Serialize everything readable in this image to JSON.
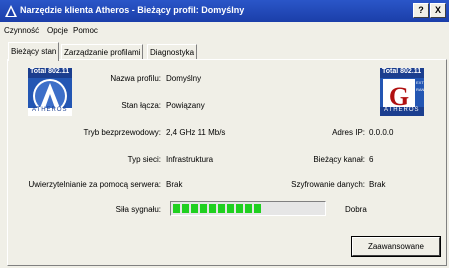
{
  "window": {
    "title": "Narzędzie klienta Atheros - Bieżący profil: Domyślny",
    "help_btn": "?",
    "close_btn": "X"
  },
  "menu": [
    "Czynność",
    "Opcje",
    "Pomoc"
  ],
  "tabs": [
    "Bieżący stan",
    "Zarządzanie profilami",
    "Diagnostyka"
  ],
  "logos": {
    "left": {
      "badge": "Total 802.11",
      "brand": "ATHEROS"
    },
    "right": {
      "badge": "Total 802.11",
      "brand": "ATHEROS",
      "side": "EXTENDED RANGE"
    }
  },
  "status": {
    "profile_name": {
      "label": "Nazwa profilu:",
      "value": "Domyślny"
    },
    "link_state": {
      "label": "Stan łącza:",
      "value": "Powiązany"
    },
    "wireless_mode": {
      "label": "Tryb bezprzewodowy:",
      "value": "2,4 GHz 11 Mb/s"
    },
    "ip_address": {
      "label": "Adres IP:",
      "value": "0.0.0.0"
    },
    "network_type": {
      "label": "Typ sieci:",
      "value": "Infrastruktura"
    },
    "current_channel": {
      "label": "Bieżący kanał:",
      "value": "6"
    },
    "server_auth": {
      "label": "Uwierzytelnianie za pomocą serwera:",
      "value": "Brak"
    },
    "data_encryption": {
      "label": "Szyfrowanie danych:",
      "value": "Brak"
    },
    "signal": {
      "label": "Siła sygnału:",
      "quality": "Dobra",
      "level_percent": 60
    }
  },
  "advanced_button": "Zaawansowane",
  "colors": {
    "titlebar": "#1b3ea9",
    "signal": "#20d020",
    "face": "#f0efe7"
  }
}
